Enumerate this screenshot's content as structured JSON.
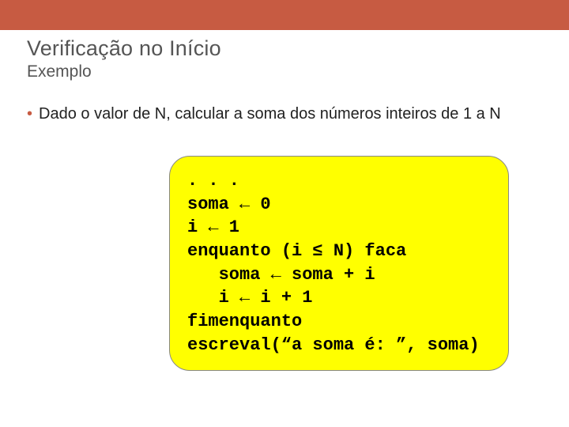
{
  "header": {
    "title": "Verificação no Início",
    "subtitle": "Exemplo"
  },
  "bullet": {
    "text": "Dado o valor de N, calcular a soma dos números inteiros de 1 a N"
  },
  "code": {
    "l1": ". . .",
    "l2": "soma ← 0",
    "l3": "i ← 1",
    "l4": "enquanto (i ≤ N) faca",
    "l5": "   soma ← soma + i",
    "l6": "   i ← i + 1",
    "l7": "fimenquanto",
    "l8": "escreval(“a soma é: ”, soma)"
  }
}
